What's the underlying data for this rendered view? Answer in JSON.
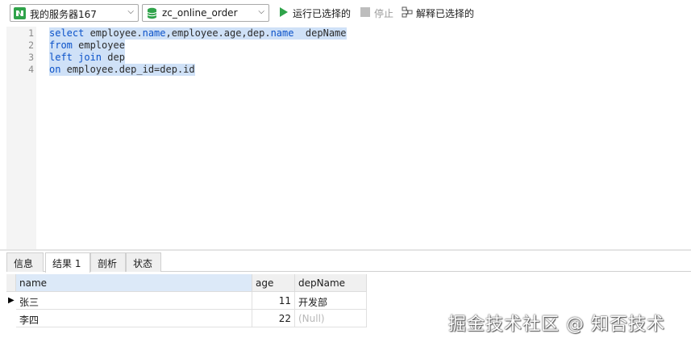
{
  "toolbar": {
    "connection": {
      "label": "我的服务器167",
      "icon": "connection-icon"
    },
    "database": {
      "label": "zc_online_order",
      "icon": "database-icon"
    },
    "run_selected": {
      "label": "运行已选择的",
      "icon": "play-icon"
    },
    "stop": {
      "label": "停止",
      "icon": "stop-icon"
    },
    "explain_selected": {
      "label": "解释已选择的",
      "icon": "explain-icon"
    }
  },
  "editor": {
    "line_numbers": [
      "1",
      "2",
      "3",
      "4"
    ],
    "lines": [
      {
        "kw": "select",
        "rest": " employee.",
        "kw2": "name",
        "rest2": ",employee.age,dep.",
        "kw3": "name",
        "rest3": "  depName"
      },
      {
        "kw": "from",
        "rest": " employee"
      },
      {
        "kw": "left join",
        "rest": " dep"
      },
      {
        "kw": "on",
        "rest": " employee.dep_id=dep.id"
      }
    ]
  },
  "tabs": [
    "信息",
    "结果 1",
    "剖析",
    "状态"
  ],
  "active_tab": "结果 1",
  "result": {
    "columns": [
      "name",
      "age",
      "depName"
    ],
    "rows": [
      [
        "张三",
        "11",
        "开发部"
      ],
      [
        "李四",
        "22",
        "(Null)"
      ]
    ]
  },
  "watermark": "掘金技术社区 @ 知否技术",
  "colors": {
    "keyword": "#0b52c9",
    "selection": "#cfe1f7",
    "run_green": "#2fa34a"
  }
}
